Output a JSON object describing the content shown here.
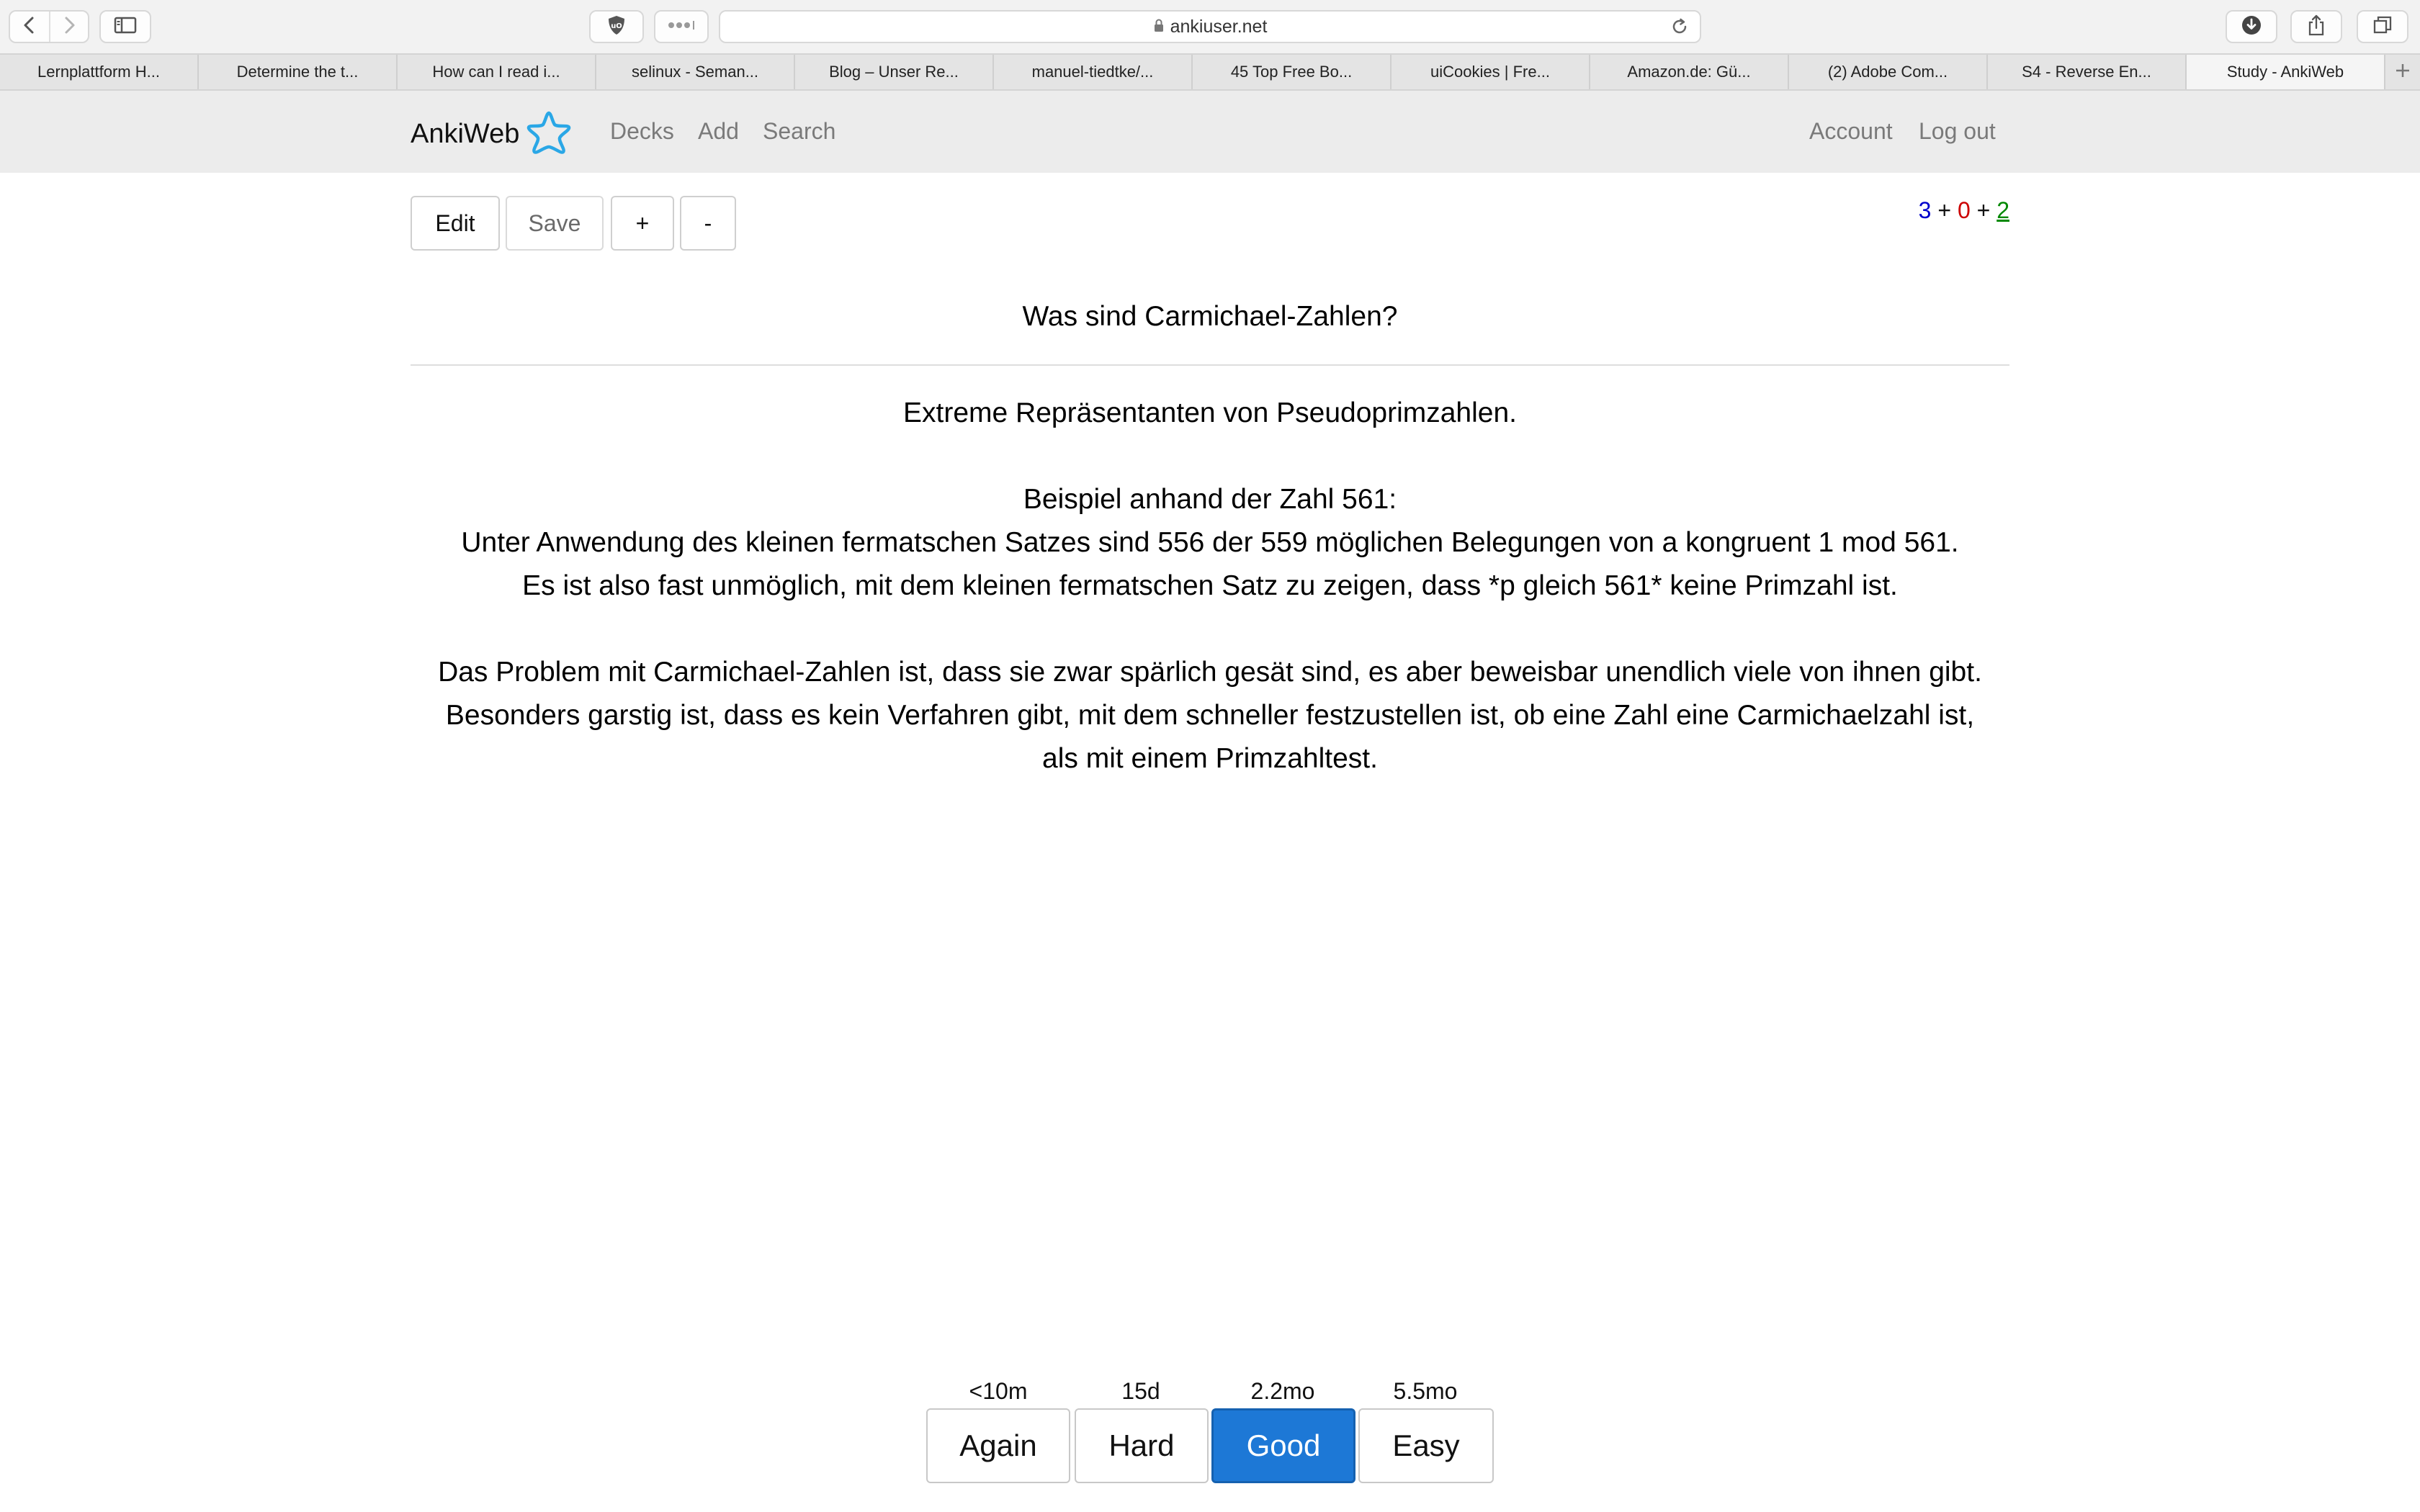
{
  "browser": {
    "url": "ankiuser.net",
    "tabs": [
      "Lernplattform H...",
      "Determine the t...",
      "How can I read i...",
      "selinux - Seman...",
      "Blog – Unser Re...",
      "manuel-tiedtke/...",
      "45 Top Free Bo...",
      "uiCookies | Fre...",
      "Amazon.de: Gü...",
      "(2) Adobe Com...",
      "S4 - Reverse En...",
      "Study - AnkiWeb"
    ],
    "active_tab_index": 11,
    "icons": [
      "back-icon",
      "forward-icon",
      "sidebar-icon",
      "shield-icon",
      "extensions-icon",
      "lock-icon",
      "reload-icon",
      "download-icon",
      "share-icon",
      "tabs-overview-icon",
      "new-tab-icon"
    ]
  },
  "nav": {
    "brand": "AnkiWeb",
    "links": {
      "decks": "Decks",
      "add": "Add",
      "search": "Search"
    },
    "account": "Account",
    "logout": "Log out",
    "logo_color": "#2aa7e6"
  },
  "controls": {
    "edit": "Edit",
    "save": "Save",
    "plus": "+",
    "minus": "-"
  },
  "counts": {
    "new": "3",
    "learn": "0",
    "review": "2",
    "sep": "+",
    "colors": {
      "new": "#0000cc",
      "learn": "#cc0000",
      "review": "#008800"
    }
  },
  "card": {
    "question": "Was sind Carmichael-Zahlen?",
    "answer": {
      "p1": "Extreme Repräsentanten von Pseudoprimzahlen.",
      "p2_lines": [
        "Beispiel anhand der Zahl 561:",
        "Unter Anwendung des kleinen fermatschen Satzes sind 556 der 559 möglichen Belegungen von a kongruent 1 mod 561.",
        "Es ist also fast unmöglich, mit dem kleinen fermatschen Satz zu zeigen, dass *p gleich 561* keine Primzahl ist."
      ],
      "p3_lines": [
        "Das Problem mit Carmichael-Zahlen ist, dass sie zwar spärlich gesät sind, es aber beweisbar unendlich viele von ihnen gibt.",
        "Besonders garstig ist, dass es kein Verfahren gibt, mit dem schneller festzustellen ist, ob eine Zahl eine Carmichaelzahl ist,",
        "als mit einem Primzahltest."
      ]
    }
  },
  "answer_buttons": [
    {
      "label": "Again",
      "interval": "<10m"
    },
    {
      "label": "Hard",
      "interval": "15d"
    },
    {
      "label": "Good",
      "interval": "2.2mo",
      "primary": true
    },
    {
      "label": "Easy",
      "interval": "5.5mo"
    }
  ],
  "accent_color": "#1d78d6"
}
